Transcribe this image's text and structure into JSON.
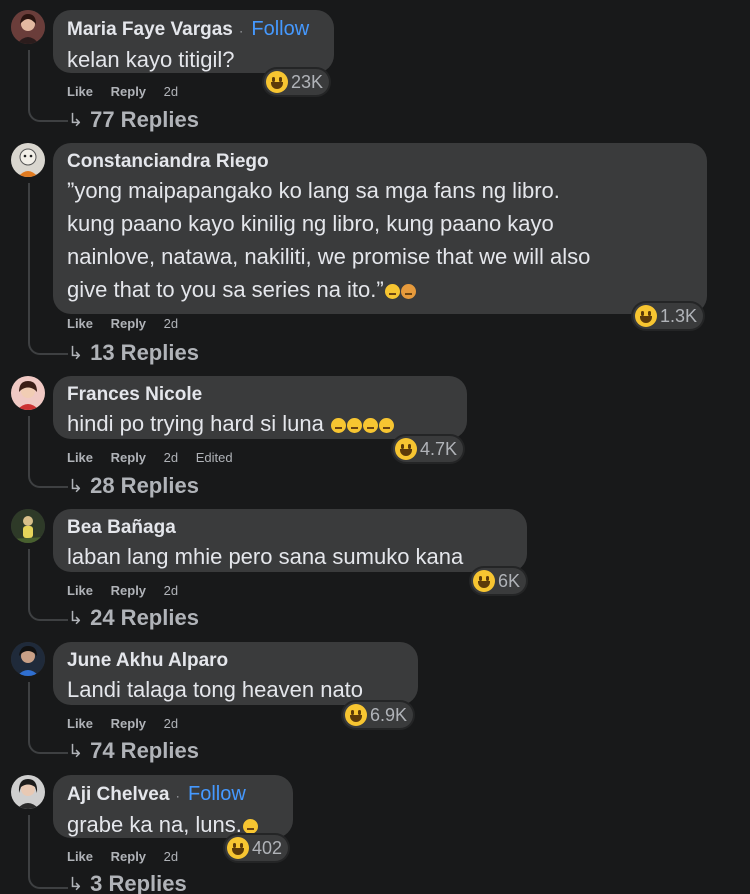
{
  "comments": [
    {
      "author": "Maria Faye Vargas",
      "follow": "Follow",
      "lines": [
        "kelan kayo titigil?"
      ],
      "reactions": "23K",
      "actions": {
        "like": "Like",
        "reply": "Reply",
        "time": "2d"
      },
      "replies": "77 Replies"
    },
    {
      "author": "Constanciandra Riego",
      "lines": [
        "”yong maipapangako ko lang sa mga fans ng libro.",
        "kung paano kayo kinilig ng libro, kung paano kayo",
        "nainlove, natawa, nakiliti, we promise that we will also",
        "give that to you sa series na ito.”"
      ],
      "reactions": "1.3K",
      "actions": {
        "like": "Like",
        "reply": "Reply",
        "time": "2d"
      },
      "replies": "13 Replies"
    },
    {
      "author": "Frances Nicole",
      "lines": [
        "hindi po trying hard si luna"
      ],
      "reactions": "4.7K",
      "actions": {
        "like": "Like",
        "reply": "Reply",
        "time": "2d",
        "edited": "Edited"
      },
      "replies": "28 Replies"
    },
    {
      "author": "Bea Bañaga",
      "lines": [
        "laban lang mhie pero sana sumuko kana"
      ],
      "reactions": "6K",
      "actions": {
        "like": "Like",
        "reply": "Reply",
        "time": "2d"
      },
      "replies": "24 Replies"
    },
    {
      "author": "June Akhu Alparo",
      "lines": [
        "Landi talaga tong heaven nato"
      ],
      "reactions": "6.9K",
      "actions": {
        "like": "Like",
        "reply": "Reply",
        "time": "2d"
      },
      "replies": "74 Replies"
    },
    {
      "author": "Aji Chelvea",
      "follow": "Follow",
      "lines": [
        "grabe ka na, luns."
      ],
      "reactions": "402",
      "actions": {
        "like": "Like",
        "reply": "Reply",
        "time": "2d"
      },
      "replies": "3 Replies"
    }
  ],
  "icons": {
    "reply_arrow": "↳",
    "reaction": "haha-reaction-icon",
    "dot": "·"
  },
  "colors": {
    "background": "#18191a",
    "bubble": "#3a3b3c",
    "follow": "#4599ff",
    "muted": "#b0b3b8"
  }
}
